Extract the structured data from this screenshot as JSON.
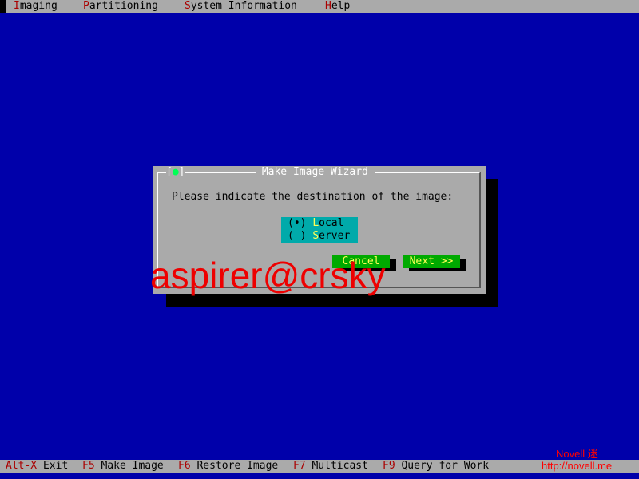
{
  "menu": {
    "items": [
      {
        "hotkey": "I",
        "rest": "maging"
      },
      {
        "hotkey": "P",
        "rest": "artitioning"
      },
      {
        "hotkey": "S",
        "rest": "ystem Information"
      },
      {
        "hotkey": "H",
        "rest": "elp"
      }
    ]
  },
  "dialog": {
    "close_box": "[●]",
    "close_open": "[",
    "close_dot": "●",
    "close_close": "]",
    "title": " Make Image Wizard ",
    "prompt": "Please indicate the destination of the image:",
    "options": [
      {
        "mark": "(•) ",
        "hotkey": "L",
        "rest": "ocal",
        "selected": true
      },
      {
        "mark": "( ) ",
        "hotkey": "S",
        "rest": "erver",
        "selected": false
      }
    ],
    "cancel_label": "Cancel",
    "next_label": "Next >>"
  },
  "watermark": "aspirer@crsky",
  "status": {
    "items": [
      {
        "key": "Alt-X",
        "label": " Exit"
      },
      {
        "key": "F5",
        "label": " Make Image"
      },
      {
        "key": "F6",
        "label": " Restore Image"
      },
      {
        "key": "F7",
        "label": " Multicast"
      },
      {
        "key": "F9",
        "label": " Query for Work"
      }
    ]
  },
  "brand": {
    "name": "Novell 迷",
    "url": "http://novell.me"
  },
  "colors": {
    "desktop": "#0000aa",
    "bar": "#aaaaaa",
    "hotkey": "#aa0000",
    "button": "#00aa00",
    "radio_bg": "#00aaaa",
    "watermark": "#ee0000"
  }
}
